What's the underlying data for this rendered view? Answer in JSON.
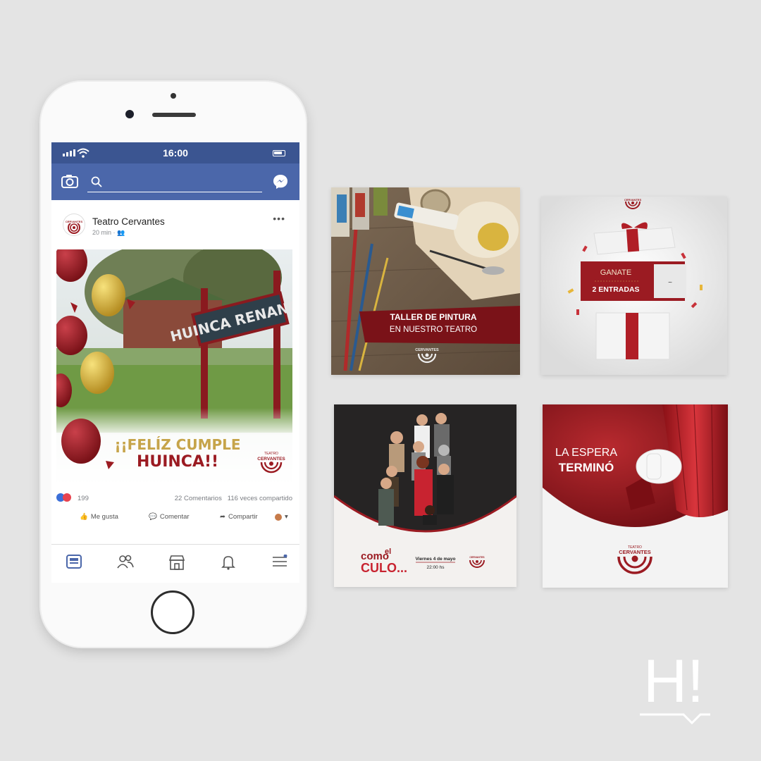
{
  "phone": {
    "status_time": "16:00",
    "post": {
      "page_name": "Teatro Cervantes",
      "time": "20 min",
      "image_text_line1": "¡¡FELÍZ CUMPLE",
      "image_text_line2": "HUINCA!!",
      "sign_text": "HUINCA RENANCO",
      "logo_top": "TEATRO",
      "logo_name": "CERVANTES",
      "reactions_count": "199",
      "comments": "22 Comentarios",
      "shares": "116 veces compartido",
      "like_label": "Me gusta",
      "comment_label": "Comentar",
      "share_label": "Compartir"
    }
  },
  "cards": {
    "painting": {
      "line1": "TALLER DE PINTURA",
      "line2": "EN NUESTRO TEATRO",
      "logo_name": "CERVANTES"
    },
    "giveaway": {
      "line1": "GANATE",
      "line2": "2 ENTRADAS",
      "logo_name": "CERVANTES"
    },
    "show": {
      "title_a": "como",
      "title_b": "el",
      "title_c": "CULO...",
      "date": "Viernes 4 de mayo",
      "time": "22:00 hs",
      "logo_name": "CERVANTES"
    },
    "curtain": {
      "line1": "LA ESPERA",
      "line2": "TERMINÓ",
      "logo_top": "TEATRO",
      "logo_name": "CERVANTES"
    }
  },
  "brand_mark": "H!",
  "colors": {
    "fb_dark": "#3b5591",
    "fb_blue": "#4b67aa",
    "teatro_red": "#9b1b22",
    "gold": "#c6a44a"
  }
}
